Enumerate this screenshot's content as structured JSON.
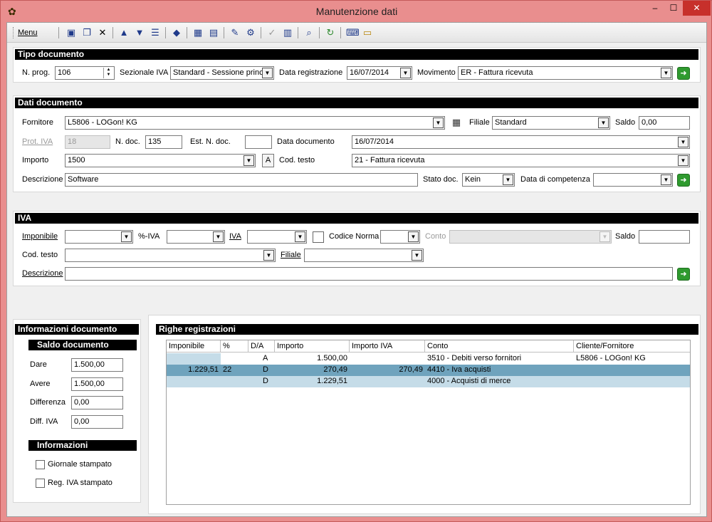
{
  "window": {
    "title": "Manutenzione dati",
    "minimize_glyph": "–",
    "maximize_glyph": "☐",
    "close_glyph": "✕"
  },
  "toolbar": {
    "menu_label": "Menu"
  },
  "tipo_documento": {
    "header": "Tipo documento",
    "n_prog_label": "N. prog.",
    "n_prog_value": "106",
    "sezionale_label": "Sezionale IVA",
    "sezionale_value": "Standard - Sessione princip",
    "data_reg_label": "Data registrazione",
    "data_reg_value": "16/07/2014",
    "movimento_label": "Movimento",
    "movimento_value": "ER - Fattura ricevuta"
  },
  "dati_documento": {
    "header": "Dati documento",
    "fornitore_label": "Fornitore",
    "fornitore_value": "L5806 - LOGon! KG",
    "filiale_label": "Filiale",
    "filiale_value": "Standard",
    "saldo_label": "Saldo",
    "saldo_value": "0,00",
    "prot_iva_label": "Prot. IVA",
    "prot_iva_value": "18",
    "n_doc_label": "N. doc.",
    "n_doc_value": "135",
    "est_n_doc_label": "Est. N. doc.",
    "est_n_doc_value": "",
    "data_doc_label": "Data documento",
    "data_doc_value": "16/07/2014",
    "importo_label": "Importo",
    "importo_value": "1500",
    "a_button": "A",
    "cod_testo_label": "Cod. testo",
    "cod_testo_value": "21 - Fattura ricevuta",
    "descrizione_label": "Descrizione",
    "descrizione_value": "Software",
    "stato_doc_label": "Stato doc.",
    "stato_doc_value": "Kein",
    "data_comp_label": "Data di competenza",
    "data_comp_value": ""
  },
  "iva": {
    "header": "IVA",
    "imponibile_label": "Imponibile",
    "perc_iva_label": "%-IVA",
    "iva_label": "IVA",
    "codice_norma_label": "Codice Norma",
    "conto_label": "Conto",
    "saldo_label": "Saldo",
    "cod_testo_label": "Cod. testo",
    "filiale_label": "Filiale",
    "descrizione_label": "Descrizione"
  },
  "info_documento": {
    "header": "Informazioni documento",
    "saldo_header": "Saldo documento",
    "dare_label": "Dare",
    "dare_value": "1.500,00",
    "avere_label": "Avere",
    "avere_value": "1.500,00",
    "differenza_label": "Differenza",
    "differenza_value": "0,00",
    "diff_iva_label": "Diff. IVA",
    "diff_iva_value": "0,00",
    "informazioni_header": "Informazioni",
    "giornale_label": "Giornale stampato",
    "reg_iva_label": "Reg. IVA stampato"
  },
  "righe": {
    "header": "Righe registrazioni",
    "columns": [
      "Imponibile",
      "%",
      "D/A",
      "Importo",
      "Importo IVA",
      "Conto",
      "Cliente/Fornitore"
    ],
    "rows": [
      {
        "imponibile": "",
        "perc": "",
        "da": "A",
        "importo": "1.500,00",
        "importo_iva": "",
        "conto": "3510 - Debiti verso fornitori",
        "cliente": "L5806 - LOGon! KG"
      },
      {
        "imponibile": "1.229,51",
        "perc": "22",
        "da": "D",
        "importo": "270,49",
        "importo_iva": "270,49",
        "conto": "4410 - Iva acquisti",
        "cliente": ""
      },
      {
        "imponibile": "",
        "perc": "",
        "da": "D",
        "importo": "1.229,51",
        "importo_iva": "",
        "conto": "4000 - Acquisti di merce",
        "cliente": ""
      }
    ]
  },
  "colors": {
    "title_bar": "#e98e8e",
    "close_button": "#c7302b",
    "section_header": "#000000",
    "selected_row": "#6fa3bd",
    "alt_row": "#c5dce8",
    "go_button": "#2f9a2f"
  }
}
